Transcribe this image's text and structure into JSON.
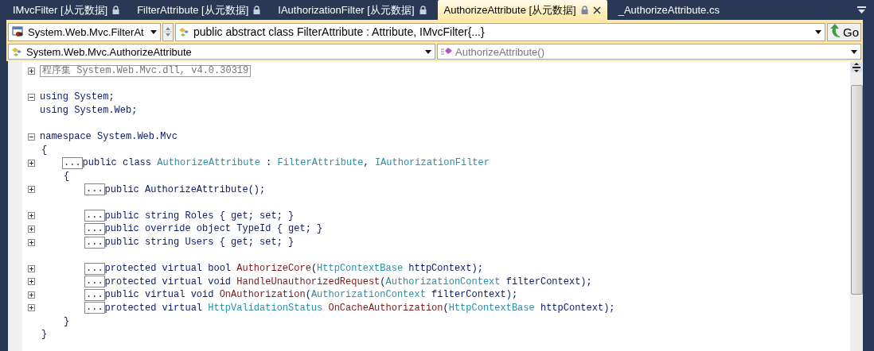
{
  "tabs": [
    {
      "label": "IMvcFilter [从元数据]",
      "locked": true,
      "closable": false,
      "selected": false
    },
    {
      "label": "FilterAttribute [从元数据]",
      "locked": true,
      "closable": false,
      "selected": false
    },
    {
      "label": "IAuthorizationFilter [从元数据]",
      "locked": true,
      "closable": false,
      "selected": false
    },
    {
      "label": "AuthorizeAttribute [从元数据]",
      "locked": true,
      "closable": true,
      "selected": true
    },
    {
      "label": "_AuthorizeAttribute.cs",
      "locked": false,
      "closable": false,
      "selected": false
    }
  ],
  "nav_bar": {
    "type_combo": "System.Web.Mvc.FilterAt",
    "member_combo": "public abstract class FilterAttribute : Attribute, IMvcFilter{...}",
    "go_button": "Go"
  },
  "nav_bar_2": {
    "class_combo": "System.Web.Mvc.AuthorizeAttribute",
    "member_combo": "AuthorizeAttribute()"
  },
  "code_lines": [
    {
      "kind": "region",
      "expanded": false,
      "tokens": [
        {
          "text": "程序集 System.Web.Mvc.dll, v4.0.30319",
          "kind": "comment"
        }
      ]
    },
    {
      "kind": "blank"
    },
    {
      "kind": "code",
      "expanded": true,
      "tokens": [
        {
          "text": "using System;",
          "kind": "plain"
        }
      ]
    },
    {
      "kind": "code",
      "tokens": [
        {
          "text": "using System.Web;",
          "kind": "plain"
        }
      ]
    },
    {
      "kind": "blank"
    },
    {
      "kind": "code",
      "expanded": true,
      "tokens": [
        {
          "text": "namespace System.Web.Mvc",
          "kind": "plain"
        }
      ],
      "children": [
        {
          "kind": "brace",
          "tokens": [
            {
              "text": "{",
              "kind": "plain"
            }
          ]
        },
        {
          "kind": "code",
          "expanded": false,
          "ellipsis": "...",
          "tokens": [
            {
              "text": "public class ",
              "kind": "plain"
            },
            {
              "text": "AuthorizeAttribute",
              "kind": "type"
            },
            {
              "text": " : ",
              "kind": "plain"
            },
            {
              "text": "FilterAttribute",
              "kind": "type"
            },
            {
              "text": ", ",
              "kind": "plain"
            },
            {
              "text": "IAuthorizationFilter",
              "kind": "type"
            }
          ],
          "children": [
            {
              "kind": "brace",
              "tokens": [
                {
                  "text": "{",
                  "kind": "plain"
                }
              ]
            },
            {
              "kind": "code",
              "expanded": false,
              "ellipsis": "...",
              "tokens": [
                {
                  "text": "public AuthorizeAttribute();",
                  "kind": "plain"
                }
              ]
            },
            {
              "kind": "blank"
            },
            {
              "kind": "code",
              "expanded": false,
              "ellipsis": "...",
              "tokens": [
                {
                  "text": "public string Roles { get; set; }",
                  "kind": "plain"
                }
              ]
            },
            {
              "kind": "code",
              "expanded": false,
              "ellipsis": "...",
              "tokens": [
                {
                  "text": "public override object TypeId { get; }",
                  "kind": "plain"
                }
              ]
            },
            {
              "kind": "code",
              "expanded": false,
              "ellipsis": "...",
              "tokens": [
                {
                  "text": "public string Users { get; set; }",
                  "kind": "plain"
                }
              ]
            },
            {
              "kind": "blank"
            },
            {
              "kind": "code",
              "expanded": false,
              "ellipsis": "...",
              "tokens": [
                {
                  "text": "protected virtual bool ",
                  "kind": "plain"
                },
                {
                  "text": "AuthorizeCore",
                  "kind": "method"
                },
                {
                  "text": "(",
                  "kind": "plain"
                },
                {
                  "text": "HttpContextBase",
                  "kind": "type"
                },
                {
                  "text": " httpContext);",
                  "kind": "plain"
                }
              ]
            },
            {
              "kind": "code",
              "expanded": false,
              "ellipsis": "...",
              "tokens": [
                {
                  "text": "protected virtual void ",
                  "kind": "plain"
                },
                {
                  "text": "HandleUnauthorizedRequest",
                  "kind": "method"
                },
                {
                  "text": "(",
                  "kind": "plain"
                },
                {
                  "text": "AuthorizationContext",
                  "kind": "type"
                },
                {
                  "text": " filterContext);",
                  "kind": "plain"
                }
              ]
            },
            {
              "kind": "code",
              "expanded": false,
              "ellipsis": "...",
              "tokens": [
                {
                  "text": "public virtual void ",
                  "kind": "plain"
                },
                {
                  "text": "OnAuthorization",
                  "kind": "method"
                },
                {
                  "text": "(",
                  "kind": "plain"
                },
                {
                  "text": "AuthorizationContext",
                  "kind": "type"
                },
                {
                  "text": " filterContext);",
                  "kind": "plain"
                }
              ]
            },
            {
              "kind": "code",
              "expanded": false,
              "ellipsis": "...",
              "tokens": [
                {
                  "text": "protected virtual ",
                  "kind": "plain"
                },
                {
                  "text": "HttpValidationStatus",
                  "kind": "type"
                },
                {
                  "text": " OnCacheAuthorization",
                  "kind": "method"
                },
                {
                  "text": "(",
                  "kind": "plain"
                },
                {
                  "text": "HttpContextBase",
                  "kind": "type"
                },
                {
                  "text": " httpContext);",
                  "kind": "plain"
                }
              ]
            },
            {
              "kind": "brace",
              "tokens": [
                {
                  "text": "}",
                  "kind": "plain"
                }
              ]
            }
          ]
        },
        {
          "kind": "brace",
          "tokens": [
            {
              "text": "}",
              "kind": "plain"
            }
          ]
        }
      ]
    }
  ]
}
